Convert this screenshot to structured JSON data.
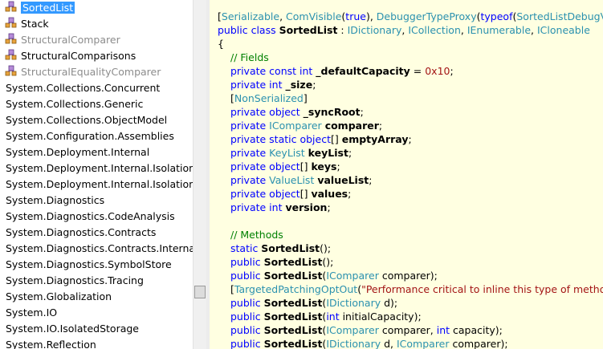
{
  "tree": {
    "items": [
      {
        "label": "SortedList",
        "type": "class",
        "selected": true,
        "grey": false,
        "icon": "class-icon"
      },
      {
        "label": "Stack",
        "type": "class",
        "selected": false,
        "grey": false,
        "icon": "class-icon"
      },
      {
        "label": "StructuralComparer",
        "type": "class",
        "selected": false,
        "grey": true,
        "icon": "class-icon"
      },
      {
        "label": "StructuralComparisons",
        "type": "class",
        "selected": false,
        "grey": false,
        "icon": "class-icon"
      },
      {
        "label": "StructuralEqualityComparer",
        "type": "class",
        "selected": false,
        "grey": true,
        "icon": "class-icon"
      },
      {
        "label": "System.Collections.Concurrent",
        "type": "namespace"
      },
      {
        "label": "System.Collections.Generic",
        "type": "namespace"
      },
      {
        "label": "System.Collections.ObjectModel",
        "type": "namespace"
      },
      {
        "label": "System.Configuration.Assemblies",
        "type": "namespace"
      },
      {
        "label": "System.Deployment.Internal",
        "type": "namespace"
      },
      {
        "label": "System.Deployment.Internal.Isolation",
        "type": "namespace"
      },
      {
        "label": "System.Deployment.Internal.Isolation.Ma",
        "type": "namespace"
      },
      {
        "label": "System.Diagnostics",
        "type": "namespace"
      },
      {
        "label": "System.Diagnostics.CodeAnalysis",
        "type": "namespace"
      },
      {
        "label": "System.Diagnostics.Contracts",
        "type": "namespace"
      },
      {
        "label": "System.Diagnostics.Contracts.Internal",
        "type": "namespace"
      },
      {
        "label": "System.Diagnostics.SymbolStore",
        "type": "namespace"
      },
      {
        "label": "System.Diagnostics.Tracing",
        "type": "namespace"
      },
      {
        "label": "System.Globalization",
        "type": "namespace"
      },
      {
        "label": "System.IO",
        "type": "namespace"
      },
      {
        "label": "System.IO.IsolatedStorage",
        "type": "namespace"
      },
      {
        "label": "System.Reflection",
        "type": "namespace"
      }
    ]
  },
  "code": {
    "lines": [
      {
        "indent": 0,
        "tokens": [
          [
            "n",
            "["
          ],
          [
            "t",
            "Serializable"
          ],
          [
            "n",
            ", "
          ],
          [
            "t",
            "ComVisible"
          ],
          [
            "n",
            "("
          ],
          [
            "k",
            "true"
          ],
          [
            "n",
            "), "
          ],
          [
            "t",
            "DebuggerTypeProxy"
          ],
          [
            "n",
            "("
          ],
          [
            "k",
            "typeof"
          ],
          [
            "n",
            "("
          ],
          [
            "t",
            "SortedListDebugView"
          ],
          [
            "n",
            ")),"
          ]
        ]
      },
      {
        "indent": 0,
        "tokens": [
          [
            "k",
            "public class "
          ],
          [
            "b",
            "SortedList"
          ],
          [
            "n",
            " : "
          ],
          [
            "t",
            "IDictionary"
          ],
          [
            "n",
            ", "
          ],
          [
            "t",
            "ICollection"
          ],
          [
            "n",
            ", "
          ],
          [
            "t",
            "IEnumerable"
          ],
          [
            "n",
            ", "
          ],
          [
            "t",
            "ICloneable"
          ]
        ]
      },
      {
        "indent": 0,
        "tokens": [
          [
            "n",
            "{"
          ]
        ]
      },
      {
        "indent": 1,
        "tokens": [
          [
            "c",
            "// Fields"
          ]
        ]
      },
      {
        "indent": 1,
        "tokens": [
          [
            "k",
            "private const int "
          ],
          [
            "b",
            "_defaultCapacity"
          ],
          [
            "n",
            " = "
          ],
          [
            "s",
            "0x10"
          ],
          [
            "n",
            ";"
          ]
        ]
      },
      {
        "indent": 1,
        "tokens": [
          [
            "k",
            "private int "
          ],
          [
            "b",
            "_size"
          ],
          [
            "n",
            ";"
          ]
        ]
      },
      {
        "indent": 1,
        "tokens": [
          [
            "n",
            "["
          ],
          [
            "t",
            "NonSerialized"
          ],
          [
            "n",
            "]"
          ]
        ]
      },
      {
        "indent": 1,
        "tokens": [
          [
            "k",
            "private object "
          ],
          [
            "b",
            "_syncRoot"
          ],
          [
            "n",
            ";"
          ]
        ]
      },
      {
        "indent": 1,
        "tokens": [
          [
            "k",
            "private "
          ],
          [
            "t",
            "IComparer "
          ],
          [
            "b",
            "comparer"
          ],
          [
            "n",
            ";"
          ]
        ]
      },
      {
        "indent": 1,
        "tokens": [
          [
            "k",
            "private static object"
          ],
          [
            "n",
            "[] "
          ],
          [
            "b",
            "emptyArray"
          ],
          [
            "n",
            ";"
          ]
        ]
      },
      {
        "indent": 1,
        "tokens": [
          [
            "k",
            "private "
          ],
          [
            "t",
            "KeyList "
          ],
          [
            "b",
            "keyList"
          ],
          [
            "n",
            ";"
          ]
        ]
      },
      {
        "indent": 1,
        "tokens": [
          [
            "k",
            "private object"
          ],
          [
            "n",
            "[] "
          ],
          [
            "b",
            "keys"
          ],
          [
            "n",
            ";"
          ]
        ]
      },
      {
        "indent": 1,
        "tokens": [
          [
            "k",
            "private "
          ],
          [
            "t",
            "ValueList "
          ],
          [
            "b",
            "valueList"
          ],
          [
            "n",
            ";"
          ]
        ]
      },
      {
        "indent": 1,
        "tokens": [
          [
            "k",
            "private object"
          ],
          [
            "n",
            "[] "
          ],
          [
            "b",
            "values"
          ],
          [
            "n",
            ";"
          ]
        ]
      },
      {
        "indent": 1,
        "tokens": [
          [
            "k",
            "private int "
          ],
          [
            "b",
            "version"
          ],
          [
            "n",
            ";"
          ]
        ]
      },
      {
        "indent": 1,
        "tokens": [
          [
            "n",
            ""
          ]
        ]
      },
      {
        "indent": 1,
        "tokens": [
          [
            "c",
            "// Methods"
          ]
        ]
      },
      {
        "indent": 1,
        "tokens": [
          [
            "k",
            "static "
          ],
          [
            "b",
            "SortedList"
          ],
          [
            "n",
            "();"
          ]
        ]
      },
      {
        "indent": 1,
        "tokens": [
          [
            "k",
            "public "
          ],
          [
            "b",
            "SortedList"
          ],
          [
            "n",
            "();"
          ]
        ]
      },
      {
        "indent": 1,
        "tokens": [
          [
            "k",
            "public "
          ],
          [
            "b",
            "SortedList"
          ],
          [
            "n",
            "("
          ],
          [
            "t",
            "IComparer"
          ],
          [
            "n",
            " comparer);"
          ]
        ]
      },
      {
        "indent": 1,
        "tokens": [
          [
            "n",
            "["
          ],
          [
            "t",
            "TargetedPatchingOptOut"
          ],
          [
            "n",
            "("
          ],
          [
            "s",
            "\"Performance critical to inline this type of method acr"
          ]
        ]
      },
      {
        "indent": 1,
        "tokens": [
          [
            "k",
            "public "
          ],
          [
            "b",
            "SortedList"
          ],
          [
            "n",
            "("
          ],
          [
            "t",
            "IDictionary"
          ],
          [
            "n",
            " d);"
          ]
        ]
      },
      {
        "indent": 1,
        "tokens": [
          [
            "k",
            "public "
          ],
          [
            "b",
            "SortedList"
          ],
          [
            "n",
            "("
          ],
          [
            "k",
            "int"
          ],
          [
            "n",
            " initialCapacity);"
          ]
        ]
      },
      {
        "indent": 1,
        "tokens": [
          [
            "k",
            "public "
          ],
          [
            "b",
            "SortedList"
          ],
          [
            "n",
            "("
          ],
          [
            "t",
            "IComparer"
          ],
          [
            "n",
            " comparer, "
          ],
          [
            "k",
            "int"
          ],
          [
            "n",
            " capacity);"
          ]
        ]
      },
      {
        "indent": 1,
        "tokens": [
          [
            "k",
            "public "
          ],
          [
            "b",
            "SortedList"
          ],
          [
            "n",
            "("
          ],
          [
            "t",
            "IDictionary"
          ],
          [
            "n",
            " d, "
          ],
          [
            "t",
            "IComparer"
          ],
          [
            "n",
            " comparer);"
          ]
        ]
      }
    ]
  }
}
